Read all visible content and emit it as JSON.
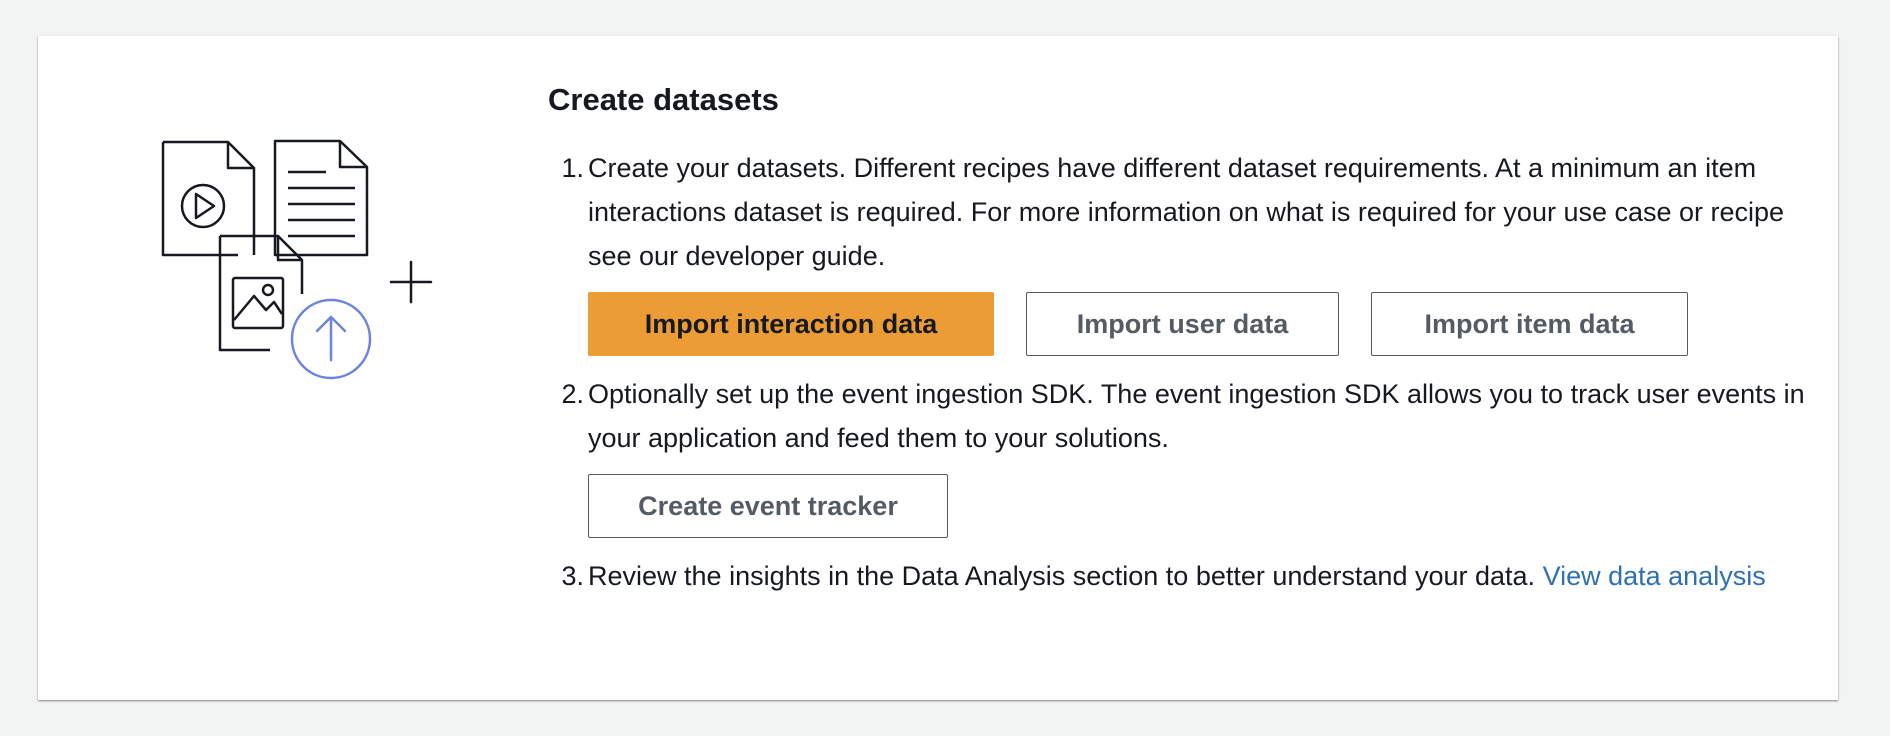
{
  "card": {
    "title": "Create datasets",
    "steps": [
      {
        "number": "1.",
        "text": "Create your datasets. Different recipes have different dataset requirements. At a minimum an item interactions dataset is required. For more information on what is required for your use case or recipe see our developer guide.",
        "buttons": {
          "import_interaction": "Import interaction data",
          "import_user": "Import user data",
          "import_item": "Import item data"
        }
      },
      {
        "number": "2.",
        "text": "Optionally set up the event ingestion SDK. The event ingestion SDK allows you to track user events in your application and feed them to your solutions.",
        "buttons": {
          "create_tracker": "Create event tracker"
        }
      },
      {
        "number": "3.",
        "text": "Review the insights in the Data Analysis section to better understand your data.",
        "link": "View data analysis"
      }
    ]
  },
  "colors": {
    "primary": "#ec9c35",
    "link": "#2f6fb3",
    "icon_accent": "#6b84e0",
    "text": "#16191f"
  },
  "icons": [
    "video-file-icon",
    "document-file-icon",
    "image-file-icon",
    "upload-icon",
    "plus-icon"
  ]
}
